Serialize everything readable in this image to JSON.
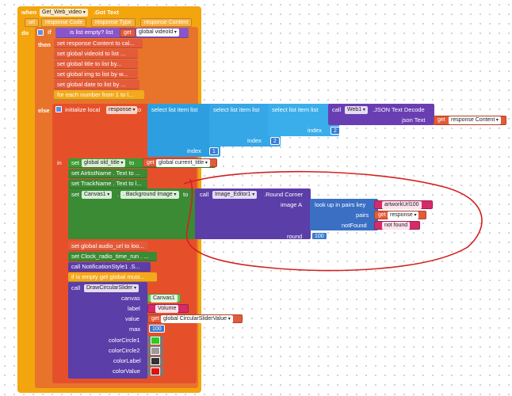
{
  "event": {
    "when": "when",
    "component": "Get_Web_video",
    "event_name": ".Got Text",
    "do": "do",
    "params": [
      "url",
      "response Code",
      "response Type",
      "response Content"
    ]
  },
  "if_block": {
    "if": "if",
    "then": "then",
    "else": "else",
    "is_list_empty": "is list empty?  list",
    "get": "get",
    "var": "global videoId"
  },
  "then_rows": [
    "set response Content to cal...",
    "set global videoId to list ...",
    "set global title to list by...",
    "set global img to list by w...",
    "set global date to list by ...",
    "for each number from 1 to l..."
  ],
  "local": {
    "initialize": "initialize local",
    "var": "response",
    "to": "to",
    "select": "select list item  list",
    "index": "index",
    "call": "call",
    "web": "Web1",
    "method": ".JSON Text Decode",
    "json_text": "json Text",
    "get": "get",
    "response_content": "response Content",
    "idx1": "1",
    "idx2": "2",
    "idx2b": "2",
    "in": "in"
  },
  "in_rows": {
    "set_old_title": "set",
    "old_title_var": "global old_title",
    "to": "to",
    "get": "get",
    "current_title": "global current_title",
    "artist": "set  AirtistName . Text  to ...",
    "track": "set  TrackName . Text  to l...",
    "canvas_set": "set",
    "canvas": "Canvas1",
    "bg_image": ".  Background Image",
    "to2": "to",
    "call": "call",
    "img_editor": "Image_Editor1",
    "round_corner": ".Round Corner",
    "image_a": "image A",
    "lookup": "look up in pairs  key",
    "key_val": "artworkUrl100",
    "pairs": "pairs",
    "get_response": "response",
    "notfound": "notFound",
    "notfound_val": "not found",
    "round": "round",
    "round_val": "100",
    "audio": "set global audio_url to loo...",
    "clock": "set  Clock_radio_time_run . ...",
    "notif": "call  NotificationStyle1 .S...",
    "ifempty": "if is empty get global musi...",
    "draw": "call",
    "draw_name": "DrawCircularSlider",
    "canvas_lbl": "canvas",
    "canvas_val": "Canvas1",
    "label_lbl": "label",
    "label_val": "Volume",
    "value_lbl": "value",
    "value_get": "get",
    "value_val": "global CircularSliderValue",
    "max_lbl": "max",
    "max_val": "100",
    "c1": "colorCircle1",
    "c2": "colorCircle2",
    "cl": "colorLabel",
    "cv": "colorValue"
  },
  "colors": {
    "colorCircle1": "#2ecc1a",
    "colorCircle2": "#9b9b9b",
    "colorLabel": "#333333",
    "colorValue": "#e01010",
    "annotation": "#d42020"
  }
}
